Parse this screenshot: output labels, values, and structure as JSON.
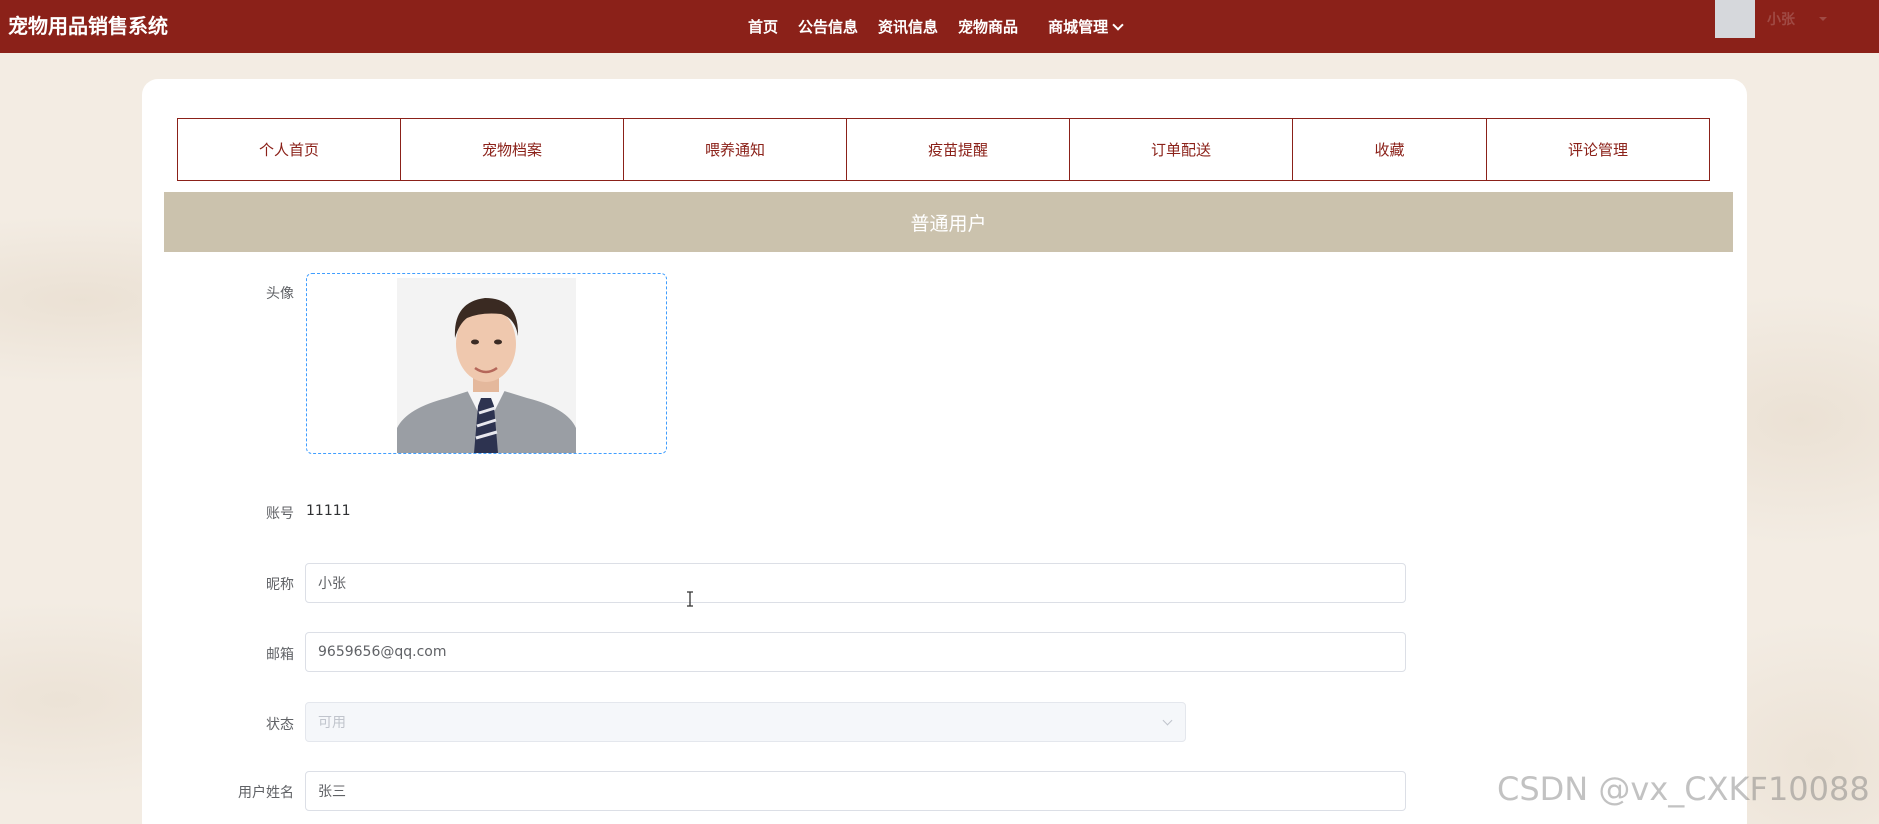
{
  "app": {
    "title": "宠物用品销售系统"
  },
  "nav": {
    "items": [
      "首页",
      "公告信息",
      "资讯信息",
      "宠物商品"
    ],
    "dropdown": "商城管理"
  },
  "user": {
    "name": "小张"
  },
  "tabs": [
    "个人首页",
    "宠物档案",
    "喂养通知",
    "疫苗提醒",
    "订单配送",
    "收藏",
    "评论管理"
  ],
  "banner": {
    "title": "普通用户"
  },
  "form": {
    "avatar_label": "头像",
    "account_label": "账号",
    "account_value": "11111",
    "nickname_label": "昵称",
    "nickname_value": "小张",
    "email_label": "邮箱",
    "email_value": "9659656@qq.com",
    "status_label": "状态",
    "status_value": "可用",
    "realname_label": "用户姓名",
    "realname_value": "张三"
  },
  "watermark": "CSDN @vx_CXKF10088",
  "colors": {
    "brand": "#8b2119",
    "banner": "#cbc2ad",
    "background": "#f3ece3"
  }
}
